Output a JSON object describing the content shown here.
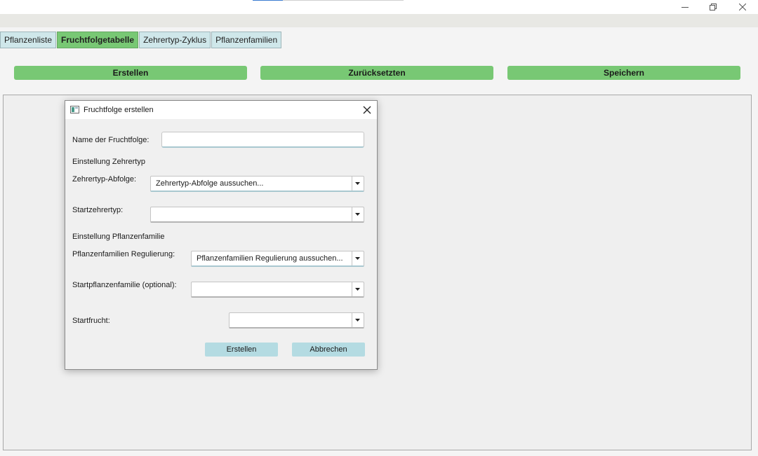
{
  "window": {
    "controls": [
      "minimize-icon",
      "restore-icon",
      "close-icon"
    ]
  },
  "tabs": [
    {
      "label": "Pflanzenliste",
      "active": false
    },
    {
      "label": "Fruchtfolgetabelle",
      "active": true
    },
    {
      "label": "Zehrertyp-Zyklus",
      "active": false
    },
    {
      "label": "Pflanzenfamilien",
      "active": false
    }
  ],
  "toolbar": {
    "create_label": "Erstellen",
    "reset_label": "Zurücksetzten",
    "save_label": "Speichern"
  },
  "dialog": {
    "title": "Fruchtfolge erstellen",
    "name_label": "Name der Fruchtfolge:",
    "name_value": "",
    "section_zehrertyp": "Einstellung Zehrertyp",
    "zehrertyp_sequence_label": "Zehrertyp-Abfolge:",
    "zehrertyp_sequence_value": "Zehrertyp-Abfolge aussuchen...",
    "start_zehrertyp_label": "Startzehrertyp:",
    "start_zehrertyp_value": "",
    "section_family": "Einstellung Pflanzenfamilie",
    "family_regulation_label": "Pflanzenfamilien Regulierung:",
    "family_regulation_value": "Pflanzenfamilien Regulierung aussuchen...",
    "start_family_label": "Startpflanzenfamilie (optional):",
    "start_family_value": "",
    "start_crop_label": "Startfrucht:",
    "start_crop_value": "",
    "create_button": "Erstellen",
    "cancel_button": "Abbrechen"
  },
  "colors": {
    "accent_green": "#78c874",
    "tab_inactive": "#cfe7ea",
    "dialog_button": "#b4dbe2",
    "focus_underline": "#a9c8d0"
  }
}
